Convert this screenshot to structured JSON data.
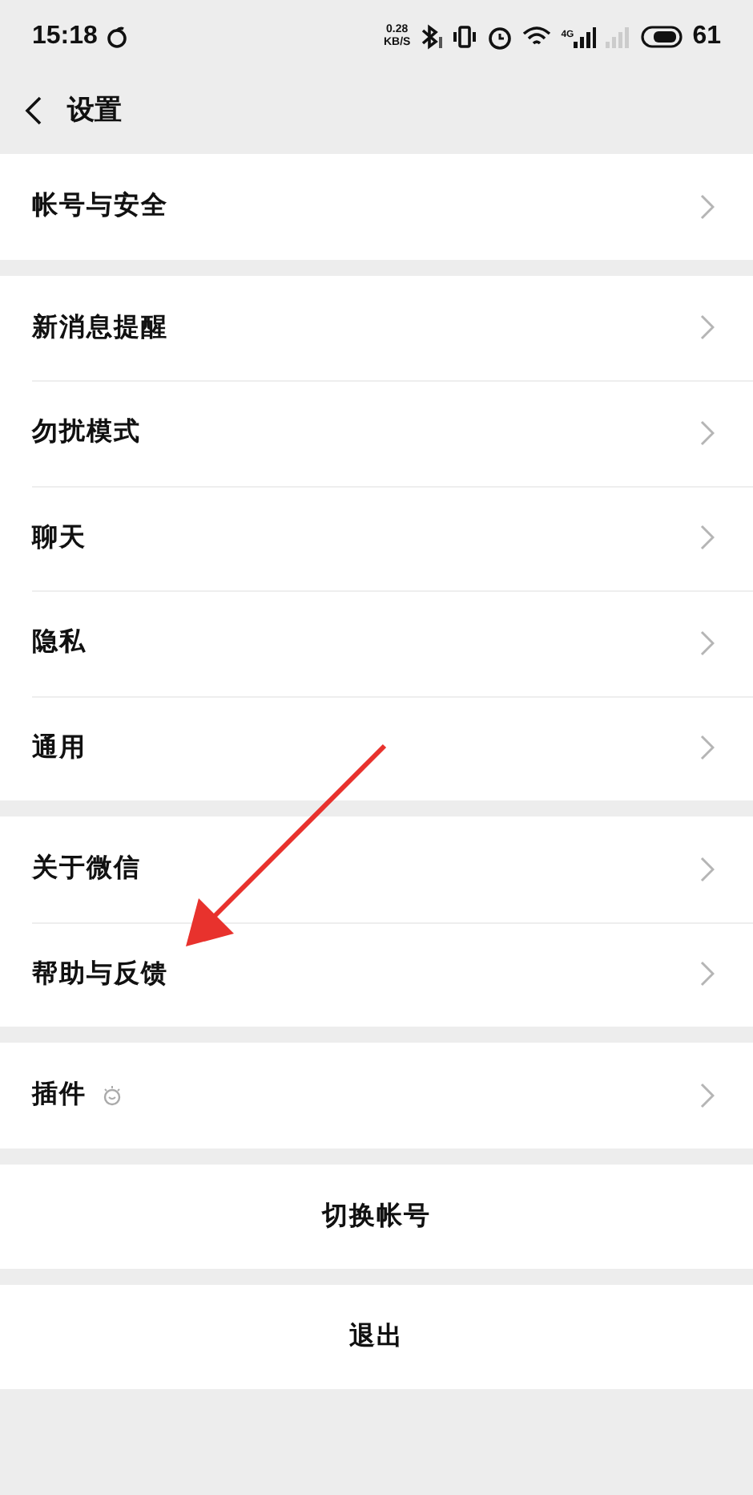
{
  "status_bar": {
    "time": "15:18",
    "net_speed": "0.28",
    "net_unit": "KB/S",
    "network": "4G",
    "battery": "61"
  },
  "nav": {
    "title": "设置"
  },
  "groups": [
    {
      "items": [
        {
          "label": "帐号与安全",
          "kind": "link"
        }
      ]
    },
    {
      "items": [
        {
          "label": "新消息提醒",
          "kind": "link"
        },
        {
          "label": "勿扰模式",
          "kind": "link"
        },
        {
          "label": "聊天",
          "kind": "link"
        },
        {
          "label": "隐私",
          "kind": "link"
        },
        {
          "label": "通用",
          "kind": "link"
        }
      ]
    },
    {
      "items": [
        {
          "label": "关于微信",
          "kind": "link"
        },
        {
          "label": "帮助与反馈",
          "kind": "link"
        }
      ]
    },
    {
      "items": [
        {
          "label": "插件",
          "kind": "plugin"
        }
      ]
    },
    {
      "items": [
        {
          "label": "切换帐号",
          "kind": "action"
        }
      ]
    },
    {
      "items": [
        {
          "label": "退出",
          "kind": "action"
        }
      ]
    }
  ]
}
